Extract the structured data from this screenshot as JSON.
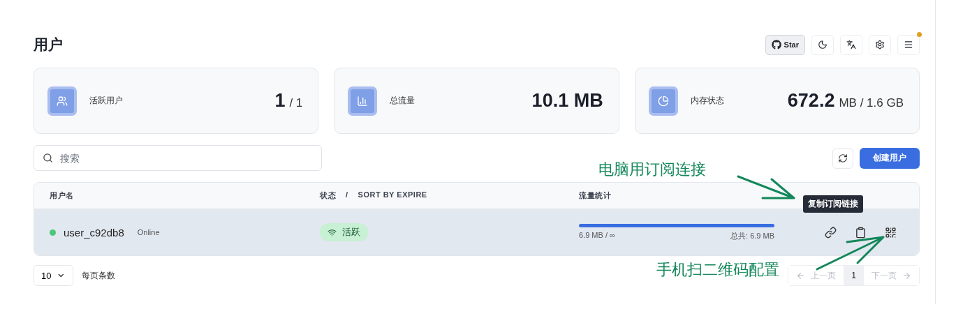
{
  "title": "用户",
  "header_actions": [
    {
      "kind": "star",
      "label": "Star"
    },
    {
      "kind": "moon"
    },
    {
      "kind": "translate"
    },
    {
      "kind": "settings"
    },
    {
      "kind": "menu",
      "notification": true
    }
  ],
  "stats": [
    {
      "kind": "users",
      "label": "活跃用户",
      "value": "1",
      "unit": "/ 1"
    },
    {
      "kind": "traffic",
      "label": "总流量",
      "value": "10.1 MB"
    },
    {
      "kind": "memory",
      "label": "内存状态",
      "value": "672.2",
      "unit": "MB / 1.6 GB"
    }
  ],
  "search": {
    "placeholder": "搜索"
  },
  "create_button": "创建用户",
  "table": {
    "columns": [
      {
        "label": "用户名"
      },
      {
        "label": "状态",
        "separator": "/",
        "sort_label": "SORT BY EXPIRE"
      },
      {
        "label": "流量统计"
      }
    ],
    "rows": [
      {
        "selected": true,
        "online": true,
        "name": "user_c92db8",
        "presence": "Online",
        "status": "活跃",
        "level": 1,
        "used": "6.9 MB / ∞",
        "total": "总共: 6.9 MB",
        "actions": [
          {
            "kind": "link"
          },
          {
            "kind": "clipboard"
          },
          {
            "kind": "qr"
          }
        ]
      }
    ]
  },
  "tooltip": "复制订阅链接",
  "pagination": {
    "page_size": "10",
    "page_size_label": "每页条数",
    "prev": "上一页",
    "prev_disabled": true,
    "pages": [
      {
        "label": "1",
        "selected": true
      }
    ],
    "next": "下一页",
    "next_disabled": true
  },
  "annotations": [
    {
      "text": "电脑用订阅连接"
    },
    {
      "text": "手机扫二维码配置"
    }
  ]
}
